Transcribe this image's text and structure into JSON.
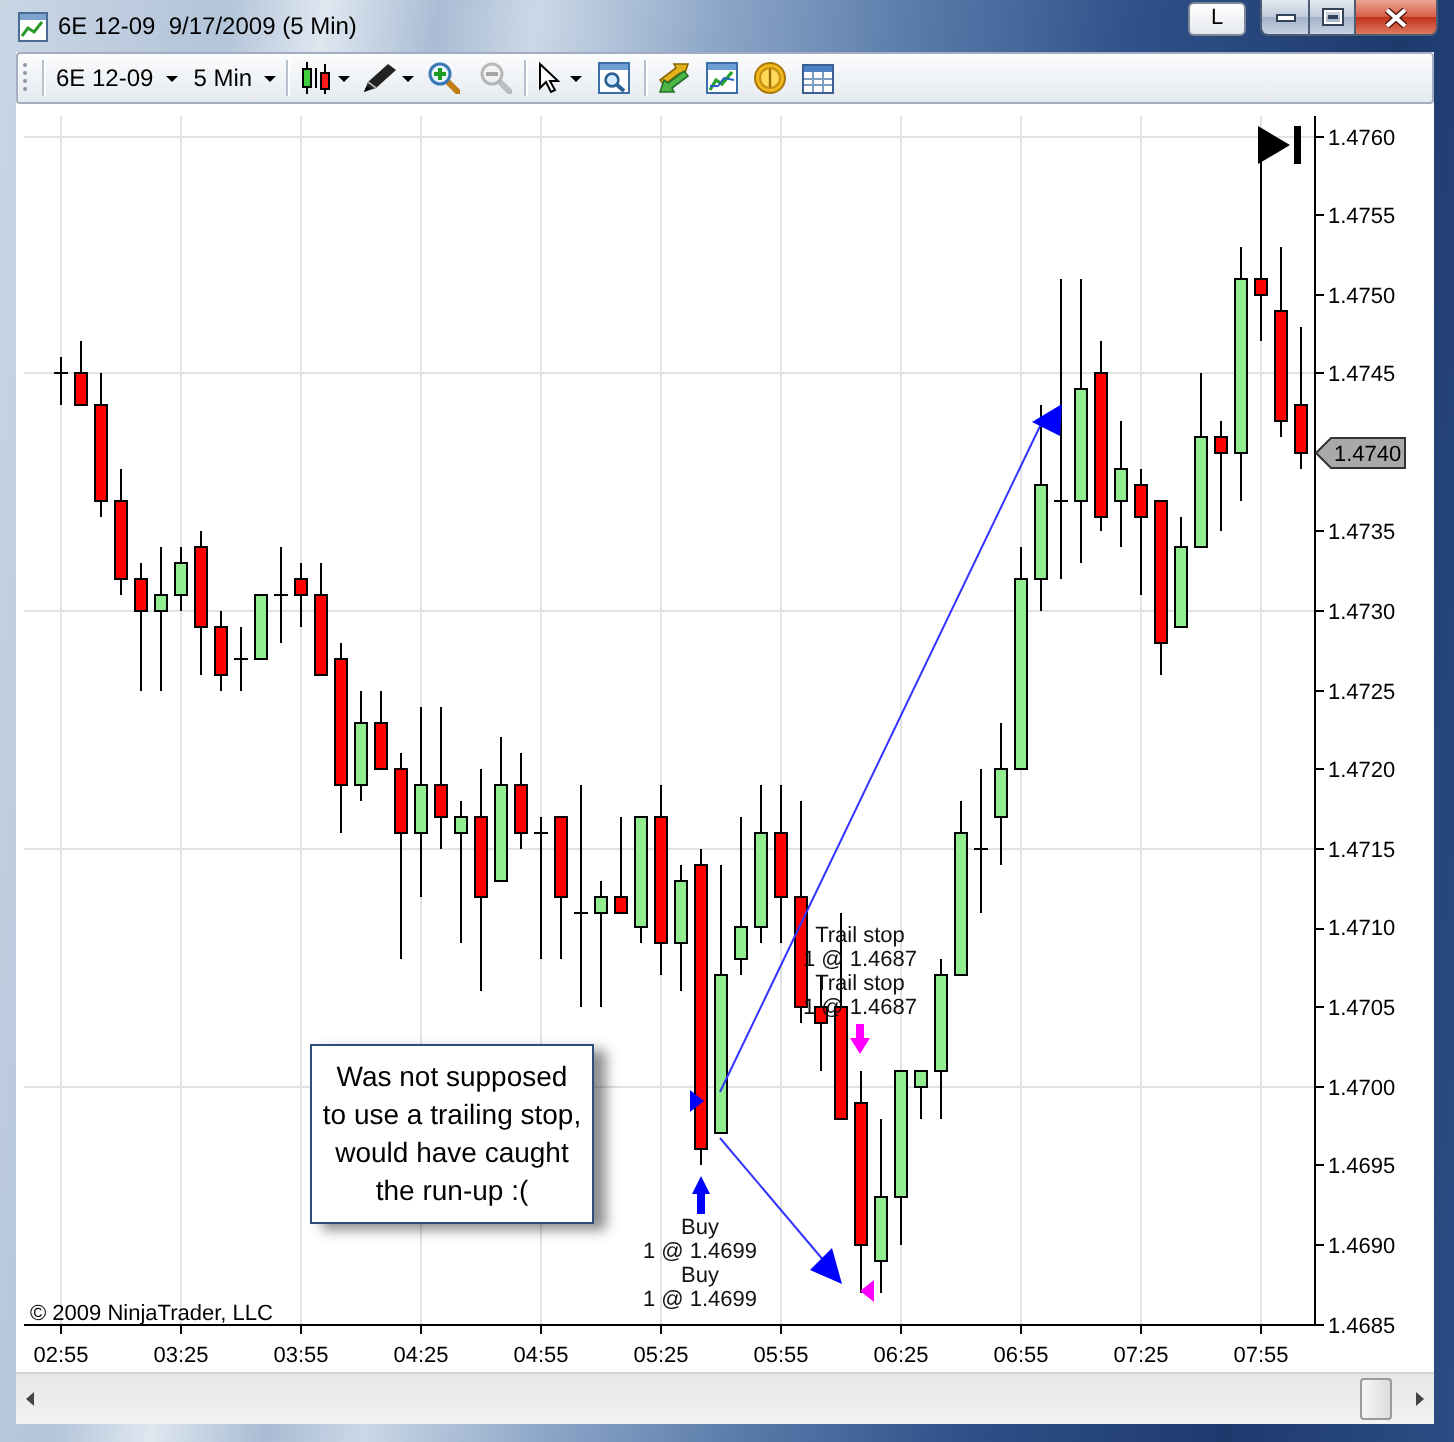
{
  "window": {
    "title": "6E 12-09  9/17/2009 (5 Min)",
    "title_button": "L"
  },
  "toolbar": {
    "instrument": "6E 12-09",
    "interval": "5 Min",
    "zoom_out": {
      "disabled": true
    }
  },
  "chart": {
    "chart_data": {
      "type": "candlestick",
      "grid": true,
      "categories": [
        "02:55",
        null,
        null,
        null,
        null,
        null,
        "03:25",
        null,
        null,
        null,
        null,
        null,
        "03:55",
        null,
        null,
        null,
        null,
        null,
        "04:25",
        null,
        null,
        null,
        null,
        null,
        "04:55",
        null,
        null,
        null,
        null,
        null,
        "05:25",
        null,
        null,
        null,
        null,
        null,
        "05:55",
        null,
        null,
        null,
        null,
        null,
        "06:25",
        null,
        null,
        null,
        null,
        null,
        "06:55",
        null,
        null,
        null,
        null,
        null,
        "07:25",
        null,
        null,
        null,
        null,
        null,
        "07:55",
        null,
        null
      ],
      "ohlc": [
        [
          1.4745,
          1.4746,
          1.4743,
          1.4745
        ],
        [
          1.4745,
          1.4747,
          1.4743,
          1.4743
        ],
        [
          1.4743,
          1.4745,
          1.4736,
          1.4737
        ],
        [
          1.4737,
          1.4739,
          1.4731,
          1.4732
        ],
        [
          1.4732,
          1.4733,
          1.4725,
          1.473
        ],
        [
          1.473,
          1.4734,
          1.4725,
          1.4731
        ],
        [
          1.4731,
          1.4734,
          1.473,
          1.4733
        ],
        [
          1.4734,
          1.4735,
          1.4726,
          1.4729
        ],
        [
          1.4729,
          1.473,
          1.4725,
          1.4726
        ],
        [
          1.4727,
          1.4729,
          1.4725,
          1.4727
        ],
        [
          1.4727,
          1.4731,
          1.4727,
          1.4731
        ],
        [
          1.4731,
          1.4734,
          1.4728,
          1.4731
        ],
        [
          1.4732,
          1.4733,
          1.4729,
          1.4731
        ],
        [
          1.4731,
          1.4733,
          1.4726,
          1.4726
        ],
        [
          1.4727,
          1.4728,
          1.4716,
          1.4719
        ],
        [
          1.4719,
          1.4725,
          1.4718,
          1.4723
        ],
        [
          1.4723,
          1.4725,
          1.472,
          1.472
        ],
        [
          1.472,
          1.4721,
          1.4708,
          1.4716
        ],
        [
          1.4716,
          1.4724,
          1.4712,
          1.4719
        ],
        [
          1.4719,
          1.4724,
          1.4715,
          1.4717
        ],
        [
          1.4716,
          1.4718,
          1.4709,
          1.4717
        ],
        [
          1.4717,
          1.472,
          1.4706,
          1.4712
        ],
        [
          1.4713,
          1.4722,
          1.4713,
          1.4719
        ],
        [
          1.4719,
          1.4721,
          1.4715,
          1.4716
        ],
        [
          1.4716,
          1.4717,
          1.4708,
          1.4716
        ],
        [
          1.4717,
          1.4717,
          1.4708,
          1.4712
        ],
        [
          1.4711,
          1.4719,
          1.4705,
          1.4711
        ],
        [
          1.4711,
          1.4713,
          1.4705,
          1.4712
        ],
        [
          1.4712,
          1.4717,
          1.4711,
          1.4711
        ],
        [
          1.471,
          1.4717,
          1.4709,
          1.4717
        ],
        [
          1.4717,
          1.4719,
          1.4707,
          1.4709
        ],
        [
          1.4709,
          1.4714,
          1.4706,
          1.4713
        ],
        [
          1.4714,
          1.4715,
          1.4695,
          1.4696
        ],
        [
          1.4697,
          1.4714,
          1.4697,
          1.4707
        ],
        [
          1.4708,
          1.4717,
          1.4707,
          1.471
        ],
        [
          1.471,
          1.4719,
          1.4709,
          1.4716
        ],
        [
          1.4716,
          1.4719,
          1.4709,
          1.4712
        ],
        [
          1.4712,
          1.4718,
          1.4704,
          1.4705
        ],
        [
          1.4705,
          1.4707,
          1.4701,
          1.4704
        ],
        [
          1.4705,
          1.4711,
          1.4698,
          1.4698
        ],
        [
          1.4699,
          1.4701,
          1.4687,
          1.469
        ],
        [
          1.4689,
          1.4698,
          1.4687,
          1.4693
        ],
        [
          1.4693,
          1.4701,
          1.469,
          1.4701
        ],
        [
          1.47,
          1.4701,
          1.4698,
          1.4701
        ],
        [
          1.4701,
          1.4708,
          1.4698,
          1.4707
        ],
        [
          1.4707,
          1.4718,
          1.4707,
          1.4716
        ],
        [
          1.4715,
          1.472,
          1.4711,
          1.4715
        ],
        [
          1.4717,
          1.4723,
          1.4714,
          1.472
        ],
        [
          1.472,
          1.4734,
          1.472,
          1.4732
        ],
        [
          1.4732,
          1.4743,
          1.473,
          1.4738
        ],
        [
          1.4737,
          1.4751,
          1.4732,
          1.4737
        ],
        [
          1.4737,
          1.4751,
          1.4733,
          1.4744
        ],
        [
          1.4745,
          1.4747,
          1.4735,
          1.4736
        ],
        [
          1.4737,
          1.4742,
          1.4734,
          1.4739
        ],
        [
          1.4738,
          1.4739,
          1.4731,
          1.4736
        ],
        [
          1.4737,
          1.4737,
          1.4726,
          1.4728
        ],
        [
          1.4729,
          1.4736,
          1.4729,
          1.4734
        ],
        [
          1.4734,
          1.4745,
          1.4734,
          1.4741
        ],
        [
          1.4741,
          1.4742,
          1.4735,
          1.474
        ],
        [
          1.474,
          1.4753,
          1.4737,
          1.4751
        ],
        [
          1.4751,
          1.4759,
          1.4747,
          1.475
        ],
        [
          1.4749,
          1.4753,
          1.4741,
          1.4742
        ],
        [
          1.4743,
          1.4748,
          1.4739,
          1.474
        ]
      ],
      "ylim": [
        1.4685,
        1.476
      ],
      "yticks": [
        {
          "value": 1.476,
          "label": "1.4760"
        },
        {
          "value": 1.4755,
          "label": "1.4755"
        },
        {
          "value": 1.475,
          "label": "1.4750"
        },
        {
          "value": 1.4745,
          "label": "1.4745"
        },
        {
          "value": 1.4735,
          "label": "1.4735"
        },
        {
          "value": 1.473,
          "label": "1.4730"
        },
        {
          "value": 1.4725,
          "label": "1.4725"
        },
        {
          "value": 1.472,
          "label": "1.4720"
        },
        {
          "value": 1.4715,
          "label": "1.4715"
        },
        {
          "value": 1.471,
          "label": "1.4710"
        },
        {
          "value": 1.4705,
          "label": "1.4705"
        },
        {
          "value": 1.47,
          "label": "1.4700"
        },
        {
          "value": 1.4695,
          "label": "1.4695"
        },
        {
          "value": 1.469,
          "label": "1.4690"
        },
        {
          "value": 1.4685,
          "label": "1.4685"
        }
      ]
    },
    "last_price": "1.4740",
    "orders": [
      {
        "kind": "sell",
        "labels": [
          {
            "title": "Trail stop",
            "detail": "1 @ 1.4687"
          },
          {
            "title": "Trail stop",
            "detail": "1 @ 1.4687"
          }
        ]
      },
      {
        "kind": "buy",
        "labels": [
          {
            "title": "Buy",
            "detail": "1 @ 1.4699"
          },
          {
            "title": "Buy",
            "detail": "1 @ 1.4699"
          }
        ]
      }
    ],
    "note": "Was not supposed\nto use a trailing stop,\nwould have caught\nthe run-up :(",
    "copyright": "© 2009 NinjaTrader, LLC"
  }
}
